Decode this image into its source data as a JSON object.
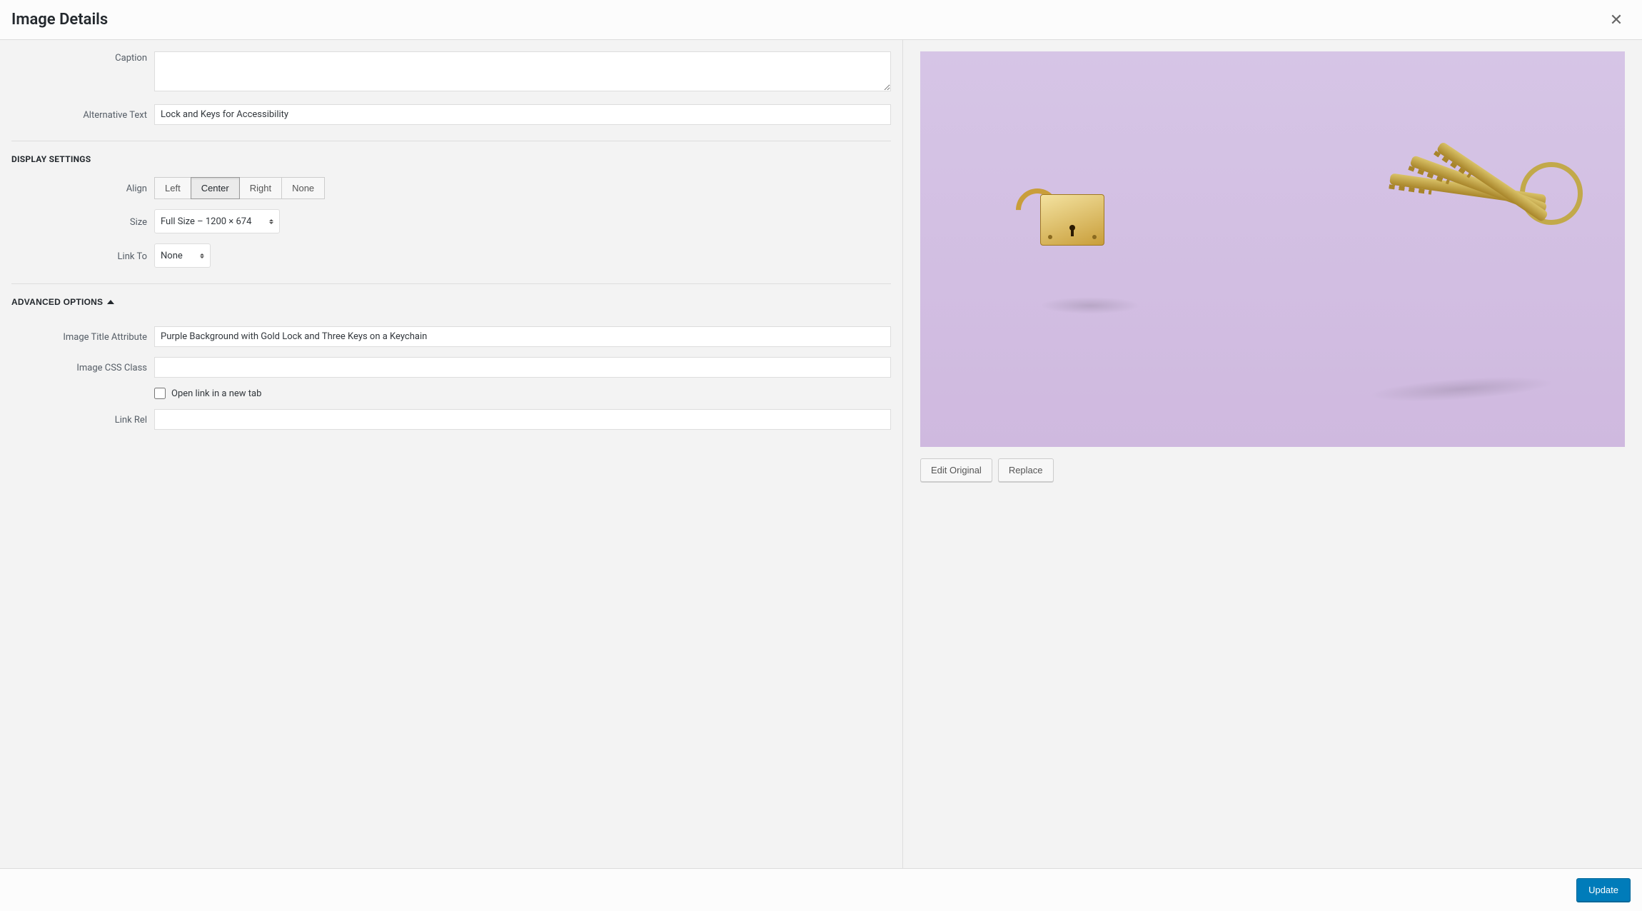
{
  "modal": {
    "title": "Image Details",
    "close_label": "Close"
  },
  "fields": {
    "caption_label": "Caption",
    "caption_value": "",
    "alt_label": "Alternative Text",
    "alt_value": "Lock and Keys for Accessibility"
  },
  "display": {
    "heading": "DISPLAY SETTINGS",
    "align_label": "Align",
    "align_options": {
      "left": "Left",
      "center": "Center",
      "right": "Right",
      "none": "None"
    },
    "align_selected": "center",
    "size_label": "Size",
    "size_selected": "Full Size – 1200 × 674",
    "linkto_label": "Link To",
    "linkto_selected": "None"
  },
  "advanced": {
    "heading": "ADVANCED OPTIONS",
    "title_attr_label": "Image Title Attribute",
    "title_attr_value": "Purple Background with Gold Lock and Three Keys on a Keychain",
    "css_class_label": "Image CSS Class",
    "css_class_value": "",
    "open_new_tab_label": "Open link in a new tab",
    "open_new_tab_checked": false,
    "link_rel_label": "Link Rel",
    "link_rel_value": ""
  },
  "preview": {
    "edit_original": "Edit Original",
    "replace": "Replace"
  },
  "footer": {
    "update": "Update"
  }
}
